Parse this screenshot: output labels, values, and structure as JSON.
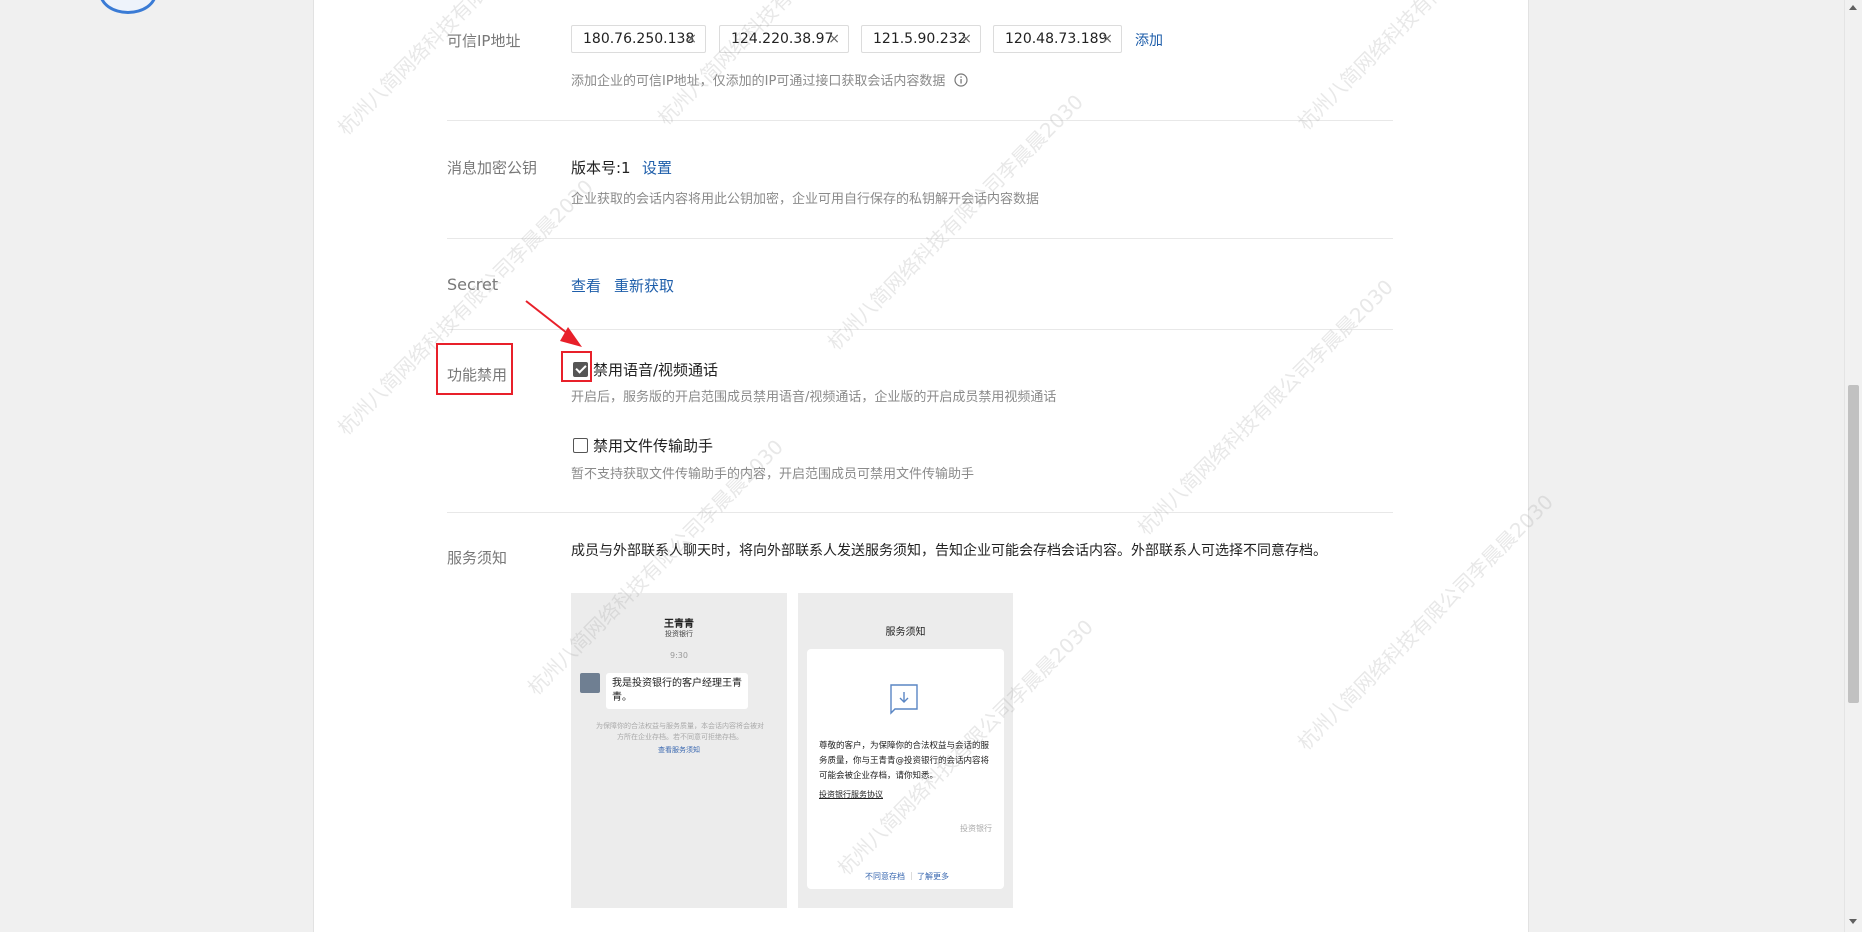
{
  "ip_section": {
    "label": "可信IP地址",
    "ips": [
      "180.76.250.138",
      "124.220.38.97",
      "121.5.90.232",
      "120.48.73.189"
    ],
    "remove_symbol": "×",
    "add_label": "添加",
    "desc": "添加企业的可信IP地址，仅添加的IP可通过接口获取会话内容数据"
  },
  "key_section": {
    "label": "消息加密公钥",
    "version": "版本号:1",
    "set_label": "设置",
    "desc": "企业获取的会话内容将用此公钥加密，企业可用自行保存的私钥解开会话内容数据"
  },
  "secret_section": {
    "label": "Secret",
    "view_label": "查看",
    "refresh_label": "重新获取"
  },
  "disable_section": {
    "label": "功能禁用",
    "options": [
      {
        "label": "禁用语音/视频通话",
        "checked": true,
        "desc": "开启后，服务版的开启范围成员禁用语音/视频通话，企业版的开启成员禁用视频通话"
      },
      {
        "label": "禁用文件传输助手",
        "checked": false,
        "desc": "暂不支持获取文件传输助手的内容，开启范围成员可禁用文件传输助手"
      }
    ]
  },
  "notice_section": {
    "label": "服务须知",
    "desc": "成员与外部联系人聊天时，将向外部联系人发送服务须知，告知企业可能会存档会话内容。外部联系人可选择不同意存档。",
    "preview_chat": {
      "name": "王青青",
      "company": "投资银行",
      "time": "9:30",
      "message": "我是投资银行的客户经理王青青。",
      "notice": "为保障你的合法权益与服务质量，本会话内容将会被对方所在企业存档。若不同意可拒绝存档。",
      "notice_link": "查看服务须知"
    },
    "preview_notice": {
      "title": "服务须知",
      "body": "尊敬的客户，为保障你的合法权益与会话的服务质量，你与王青青@投资银行的会话内容将可能会被企业存档，请你知悉。",
      "agreement": "投资银行服务协议",
      "sign": "投资银行",
      "reject": "不同意存档",
      "learn_more": "了解更多"
    }
  },
  "watermark_text": "杭州八简网络科技有限公司李晨晨2030",
  "colors": {
    "link": "#1e5eaa",
    "annotation_red": "#e8202a"
  }
}
